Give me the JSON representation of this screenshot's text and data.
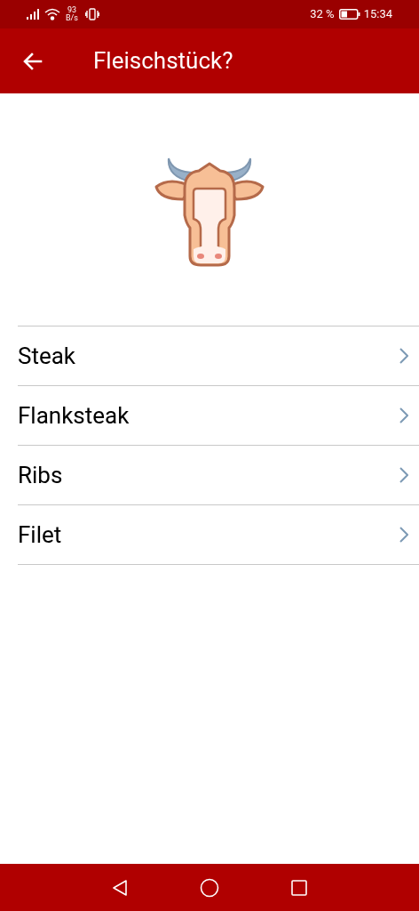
{
  "status_bar": {
    "net_speed_value": "93",
    "net_speed_unit": "B/s",
    "battery": "32 %",
    "time": "15:34"
  },
  "header": {
    "title": "Fleischstück?"
  },
  "items": [
    {
      "label": "Steak"
    },
    {
      "label": "Flanksteak"
    },
    {
      "label": "Ribs"
    },
    {
      "label": "Filet"
    }
  ]
}
